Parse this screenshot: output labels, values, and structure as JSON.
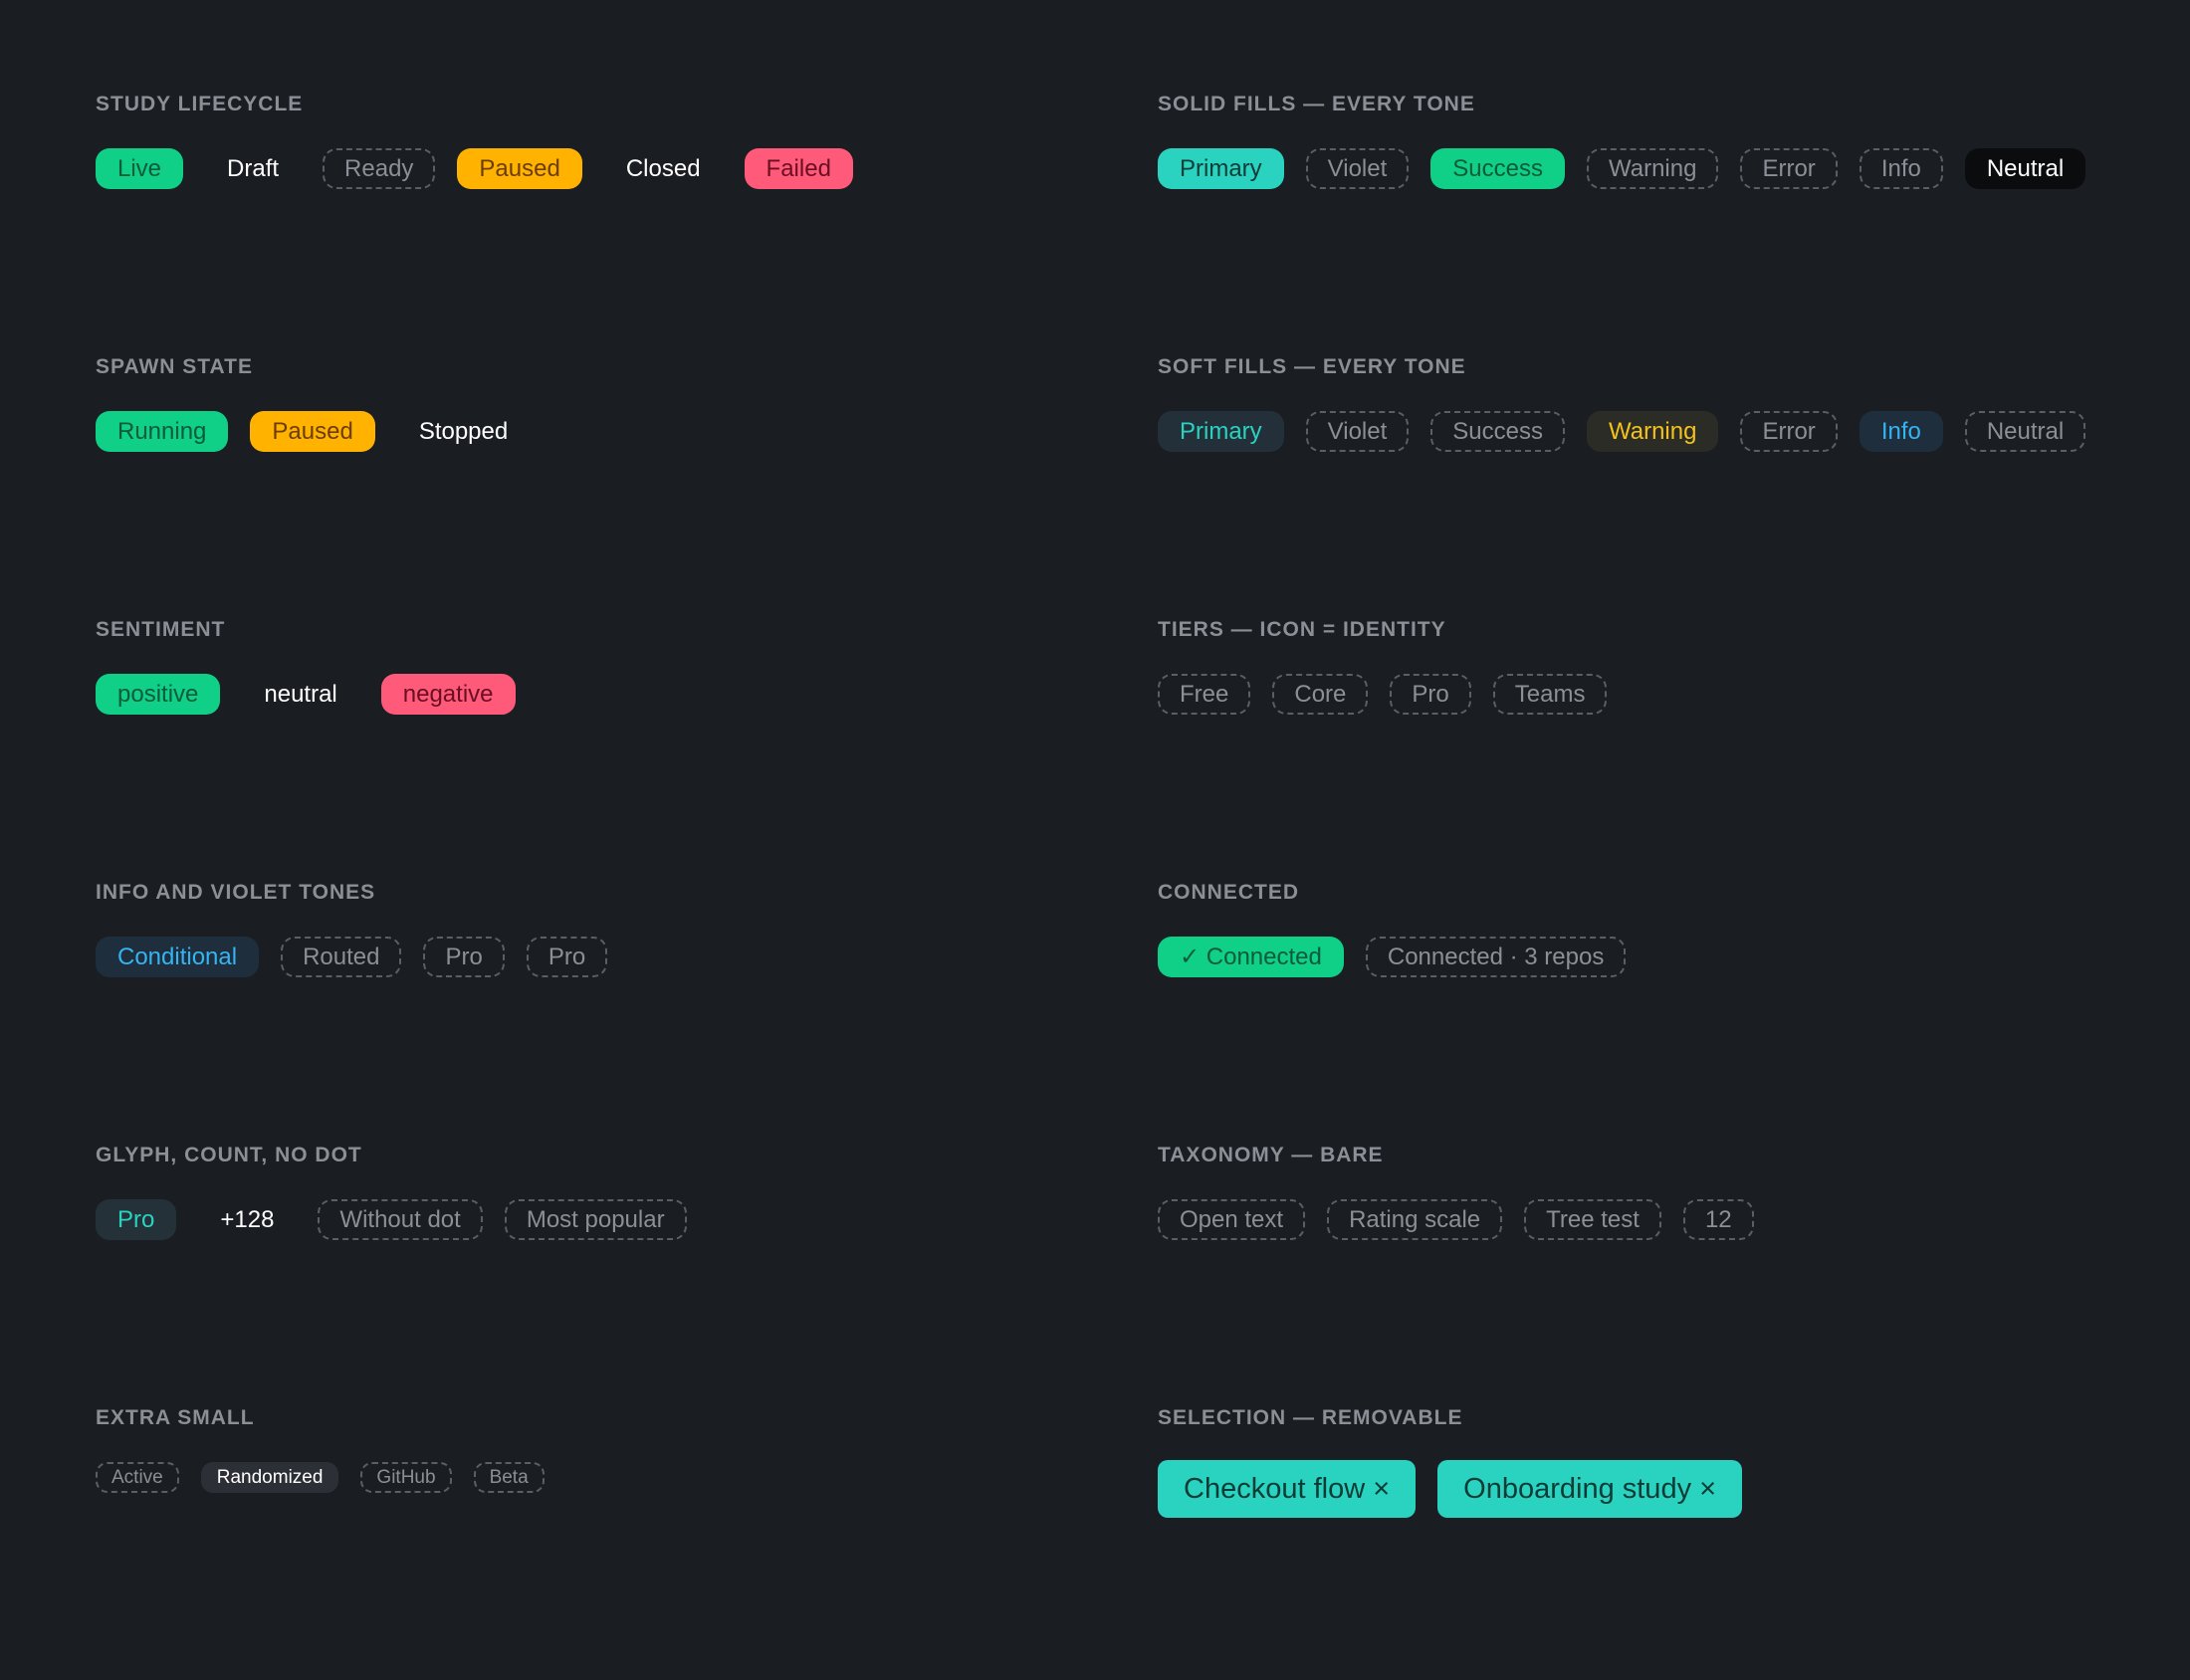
{
  "sections": {
    "study_lifecycle": {
      "title": "STUDY LIFECYCLE",
      "badges": [
        "Live",
        "Draft",
        "Ready",
        "Paused",
        "Closed",
        "Failed"
      ]
    },
    "solid_fills": {
      "title": "SOLID FILLS — EVERY TONE",
      "badges": [
        "Primary",
        "Violet",
        "Success",
        "Warning",
        "Error",
        "Info",
        "Neutral"
      ]
    },
    "spawn_state": {
      "title": "SPAWN STATE",
      "badges": [
        "Running",
        "Paused",
        "Stopped"
      ]
    },
    "soft_fills": {
      "title": "SOFT FILLS — EVERY TONE",
      "badges": [
        "Primary",
        "Violet",
        "Success",
        "Warning",
        "Error",
        "Info",
        "Neutral"
      ]
    },
    "sentiment": {
      "title": "SENTIMENT",
      "badges": [
        "positive",
        "neutral",
        "negative"
      ]
    },
    "tiers": {
      "title": "TIERS — ICON = IDENTITY",
      "badges": [
        "Free",
        "Core",
        "Pro",
        "Teams"
      ]
    },
    "info_violet": {
      "title": "INFO AND VIOLET TONES",
      "badges": [
        "Conditional",
        "Routed",
        "Pro",
        "Pro"
      ]
    },
    "connected": {
      "title": "CONNECTED",
      "badges": [
        "✓ Connected",
        "Connected · 3 repos"
      ]
    },
    "glyph_count": {
      "title": "GLYPH, COUNT, NO DOT",
      "badges": [
        "Pro",
        "+128",
        "Without dot",
        "Most popular"
      ]
    },
    "taxonomy": {
      "title": "TAXONOMY — BARE",
      "badges": [
        "Open text",
        "Rating scale",
        "Tree test",
        "12"
      ]
    },
    "extra_small": {
      "title": "EXTRA SMALL",
      "badges": [
        "Active",
        "Randomized",
        "GitHub",
        "Beta"
      ]
    },
    "selection": {
      "title": "SELECTION — REMOVABLE",
      "badges": [
        "Checkout flow ×",
        "Onboarding study ×"
      ]
    }
  },
  "colors": {
    "background": "#1a1d22",
    "title": "#8b9096",
    "success": "#10cf87",
    "warning": "#ffb300",
    "error": "#ff5a7a",
    "primary": "#2ad2c0",
    "info": "#34b4f2"
  }
}
